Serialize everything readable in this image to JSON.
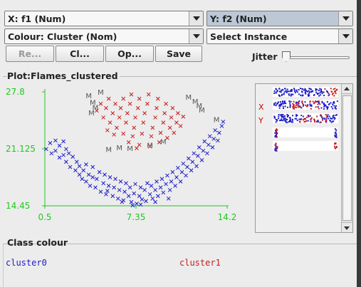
{
  "controls": {
    "x_axis": "X: f1 (Num)",
    "y_axis": "Y: f2 (Num)",
    "colour": "Colour: Cluster (Nom)",
    "instance": "Select Instance",
    "buttons": {
      "reset": "Re...",
      "clear": "Cl...",
      "open": "Op...",
      "save": "Save"
    },
    "jitter_label": "Jitter",
    "jitter_value": 0
  },
  "plot": {
    "title": "Plot:Flames_clustered",
    "x_ticks": [
      "0.5",
      "7.35",
      "14.2"
    ],
    "y_ticks": [
      "27.8",
      "21.125",
      "14.45"
    ],
    "colors": {
      "cluster0": "#1c1cc8",
      "cluster1": "#c81c1c",
      "axis": "#1fc81f",
      "marker": "#555555"
    }
  },
  "attributes": {
    "markers": [
      "X",
      "Y"
    ]
  },
  "legend": {
    "title": "Class colour",
    "items": [
      {
        "label": "cluster0",
        "color": "#1c1cc8"
      },
      {
        "label": "cluster1",
        "color": "#c81c1c"
      }
    ]
  },
  "chart_data": {
    "type": "scatter",
    "xlim": [
      0.5,
      14.2
    ],
    "ylim": [
      14.45,
      27.8
    ],
    "series": [
      {
        "name": "cluster0",
        "marker": "x",
        "points": [
          [
            0.6,
            21.1
          ],
          [
            0.9,
            21.8
          ],
          [
            1.0,
            20.6
          ],
          [
            1.3,
            22.1
          ],
          [
            1.3,
            20.9
          ],
          [
            1.6,
            21.5
          ],
          [
            1.6,
            20.1
          ],
          [
            1.9,
            22.0
          ],
          [
            1.9,
            20.4
          ],
          [
            2.1,
            21.1
          ],
          [
            2.1,
            19.6
          ],
          [
            2.3,
            20.6
          ],
          [
            2.4,
            19.0
          ],
          [
            2.6,
            20.2
          ],
          [
            2.8,
            18.6
          ],
          [
            2.9,
            19.6
          ],
          [
            3.1,
            18.1
          ],
          [
            3.1,
            19.1
          ],
          [
            3.3,
            17.6
          ],
          [
            3.4,
            18.6
          ],
          [
            3.6,
            19.3
          ],
          [
            3.6,
            17.3
          ],
          [
            3.8,
            18.1
          ],
          [
            3.9,
            16.8
          ],
          [
            4.1,
            17.8
          ],
          [
            4.1,
            19.0
          ],
          [
            4.3,
            16.6
          ],
          [
            4.4,
            17.6
          ],
          [
            4.6,
            18.4
          ],
          [
            4.7,
            16.1
          ],
          [
            4.9,
            17.1
          ],
          [
            5.0,
            18.1
          ],
          [
            5.1,
            15.8
          ],
          [
            5.3,
            16.8
          ],
          [
            5.4,
            17.8
          ],
          [
            5.6,
            15.6
          ],
          [
            5.7,
            16.6
          ],
          [
            5.8,
            17.6
          ],
          [
            6.0,
            15.3
          ],
          [
            6.1,
            16.3
          ],
          [
            6.2,
            17.3
          ],
          [
            6.4,
            15.1
          ],
          [
            6.5,
            16.1
          ],
          [
            6.6,
            17.1
          ],
          [
            6.8,
            15.6
          ],
          [
            6.9,
            16.6
          ],
          [
            7.0,
            14.9
          ],
          [
            7.2,
            15.9
          ],
          [
            7.3,
            17.0
          ],
          [
            7.4,
            14.7
          ],
          [
            7.6,
            15.6
          ],
          [
            7.7,
            16.6
          ],
          [
            7.8,
            15.2
          ],
          [
            8.0,
            16.3
          ],
          [
            8.1,
            15.0
          ],
          [
            8.2,
            17.1
          ],
          [
            8.4,
            15.8
          ],
          [
            8.5,
            16.8
          ],
          [
            8.6,
            15.3
          ],
          [
            8.8,
            16.3
          ],
          [
            8.9,
            17.3
          ],
          [
            9.0,
            15.6
          ],
          [
            9.2,
            16.6
          ],
          [
            9.3,
            17.6
          ],
          [
            9.4,
            16.0
          ],
          [
            9.6,
            17.0
          ],
          [
            9.7,
            18.0
          ],
          [
            9.9,
            16.3
          ],
          [
            10.0,
            17.3
          ],
          [
            10.1,
            18.4
          ],
          [
            10.3,
            16.8
          ],
          [
            10.4,
            17.8
          ],
          [
            10.5,
            18.9
          ],
          [
            10.7,
            17.3
          ],
          [
            10.8,
            18.4
          ],
          [
            10.9,
            19.4
          ],
          [
            11.1,
            18.0
          ],
          [
            11.2,
            19.0
          ],
          [
            11.3,
            20.0
          ],
          [
            11.5,
            18.6
          ],
          [
            11.6,
            19.6
          ],
          [
            11.7,
            20.6
          ],
          [
            11.9,
            19.1
          ],
          [
            12.0,
            20.3
          ],
          [
            12.1,
            21.3
          ],
          [
            12.3,
            19.8
          ],
          [
            12.4,
            20.9
          ],
          [
            12.5,
            22.0
          ],
          [
            12.7,
            20.6
          ],
          [
            12.8,
            21.6
          ],
          [
            12.9,
            22.6
          ],
          [
            13.1,
            21.3
          ],
          [
            13.2,
            22.3
          ],
          [
            13.3,
            23.3
          ],
          [
            13.5,
            22.1
          ],
          [
            13.6,
            23.0
          ],
          [
            13.8,
            23.8
          ],
          [
            13.9,
            24.3
          ],
          [
            7.1,
            14.5
          ],
          [
            7.7,
            14.6
          ],
          [
            6.3,
            14.9
          ],
          [
            8.8,
            14.9
          ],
          [
            5.2,
            16.2
          ],
          [
            9.8,
            15.3
          ]
        ]
      },
      {
        "name": "cluster1",
        "marker": "x",
        "points": [
          [
            4.4,
            25.6
          ],
          [
            4.7,
            26.4
          ],
          [
            4.9,
            24.8
          ],
          [
            5.1,
            25.9
          ],
          [
            5.3,
            27.0
          ],
          [
            5.4,
            24.2
          ],
          [
            5.6,
            25.3
          ],
          [
            5.8,
            26.4
          ],
          [
            5.9,
            23.6
          ],
          [
            6.1,
            24.8
          ],
          [
            6.2,
            25.9
          ],
          [
            6.4,
            27.0
          ],
          [
            6.4,
            22.9
          ],
          [
            6.6,
            24.2
          ],
          [
            6.7,
            25.3
          ],
          [
            6.9,
            26.4
          ],
          [
            7.0,
            27.5
          ],
          [
            7.1,
            22.6
          ],
          [
            7.2,
            23.6
          ],
          [
            7.3,
            24.8
          ],
          [
            7.5,
            25.9
          ],
          [
            7.6,
            27.0
          ],
          [
            7.6,
            21.6
          ],
          [
            7.8,
            22.9
          ],
          [
            7.9,
            24.2
          ],
          [
            8.0,
            25.3
          ],
          [
            8.2,
            26.4
          ],
          [
            8.3,
            27.5
          ],
          [
            8.4,
            21.4
          ],
          [
            8.5,
            22.6
          ],
          [
            8.6,
            23.6
          ],
          [
            8.8,
            24.8
          ],
          [
            8.9,
            25.9
          ],
          [
            9.0,
            27.0
          ],
          [
            9.1,
            21.9
          ],
          [
            9.2,
            23.0
          ],
          [
            9.4,
            24.2
          ],
          [
            9.5,
            25.3
          ],
          [
            9.6,
            26.4
          ],
          [
            9.7,
            22.4
          ],
          [
            9.9,
            23.6
          ],
          [
            10.0,
            24.8
          ],
          [
            10.1,
            25.9
          ],
          [
            10.2,
            23.0
          ],
          [
            10.4,
            24.2
          ],
          [
            10.5,
            25.3
          ],
          [
            10.7,
            23.8
          ],
          [
            10.9,
            24.9
          ],
          [
            6.8,
            21.9
          ],
          [
            7.4,
            21.2
          ],
          [
            5.2,
            23.3
          ],
          [
            5.7,
            22.8
          ]
        ]
      },
      {
        "name": "M",
        "marker": "M",
        "points": [
          [
            3.8,
            27.4
          ],
          [
            4.7,
            27.8
          ],
          [
            4.1,
            26.6
          ],
          [
            4.3,
            26.0
          ],
          [
            4.0,
            25.4
          ],
          [
            11.3,
            27.2
          ],
          [
            11.8,
            26.7
          ],
          [
            12.1,
            26.2
          ],
          [
            12.3,
            25.7
          ],
          [
            13.4,
            24.6
          ],
          [
            5.3,
            21.1
          ],
          [
            6.1,
            21.3
          ],
          [
            6.9,
            21.2
          ],
          [
            8.4,
            21.6
          ],
          [
            9.4,
            22.0
          ]
        ]
      }
    ]
  }
}
